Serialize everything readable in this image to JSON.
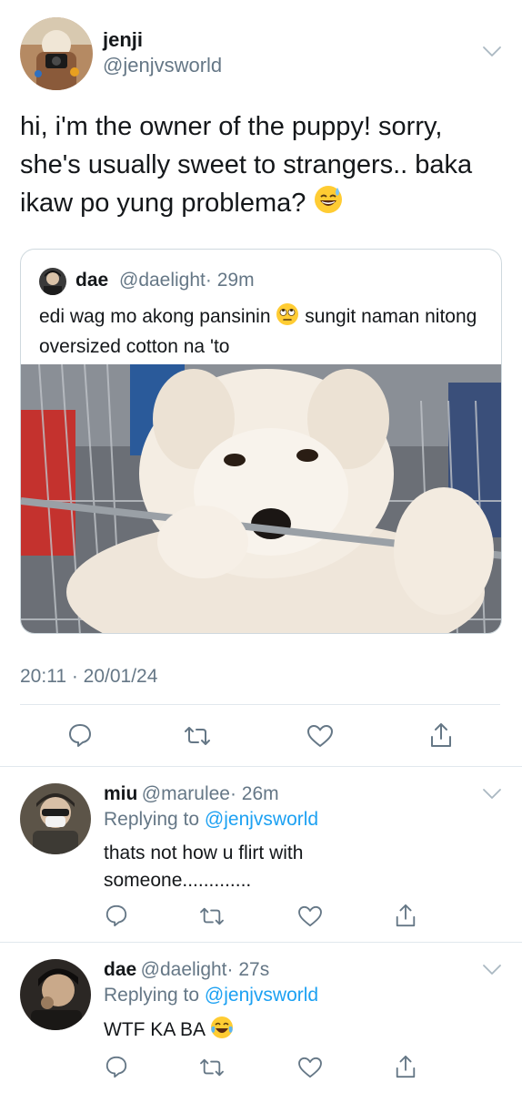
{
  "main_tweet": {
    "display_name": "jenji",
    "handle": "@jenjvsworld",
    "text": "hi, i'm the owner of the puppy! sorry, she's usually sweet to strangers.. baka ikaw po yung problema?",
    "timestamp": "20:11 · 20/01/24",
    "quoted": {
      "display_name": "dae",
      "handle": "@daelight",
      "time": "· 29m",
      "text_part1": "edi wag mo akong pansinin",
      "text_part2": "sungit naman nitong oversized cotton na 'to",
      "image": "fluffy-white-puppy-in-shopping-cart"
    },
    "icons": [
      "chevron-down-icon",
      "reply-icon",
      "retweet-icon",
      "like-icon",
      "share-icon"
    ]
  },
  "replies": [
    {
      "display_name": "miu",
      "handle": "@marulee",
      "time": "· 26m",
      "replying_label": "Replying to",
      "replying_handle": "@jenjvsworld",
      "text": "thats not how u flirt with someone............."
    },
    {
      "display_name": "dae",
      "handle": "@daelight",
      "time": "· 27s",
      "replying_label": "Replying to",
      "replying_handle": "@jenjvsworld",
      "text": "WTF KA BA"
    }
  ],
  "colors": {
    "link": "#1da1f2",
    "muted": "#657786",
    "divider": "#e1e8ed"
  }
}
